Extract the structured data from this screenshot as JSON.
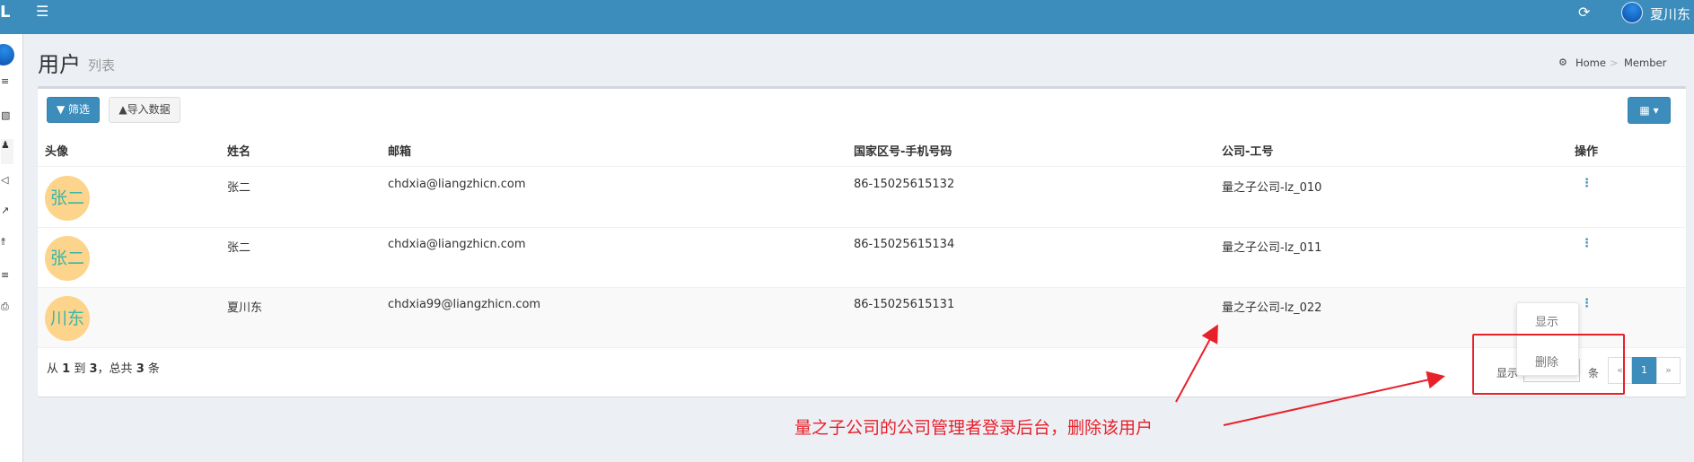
{
  "topbar": {
    "logo_letter": "L",
    "menu_icon": "hamburger-icon",
    "refresh_icon": "refresh-icon",
    "user_name": "夏川东"
  },
  "sidebar": {
    "icons": [
      "bars-icon",
      "book-icon",
      "user-icon",
      "megaphone-icon",
      "share-arrow-icon",
      "network-icon",
      "list-icon",
      "printer-icon"
    ]
  },
  "page": {
    "title": "用户",
    "subtitle": "列表"
  },
  "breadcrumb": {
    "home_icon": "dashboard-icon",
    "home": "Home",
    "separator": ">",
    "current": "Member"
  },
  "toolbar": {
    "filter_label": "筛选",
    "import_label": "导入数据",
    "columns_icon": "table-icon"
  },
  "table": {
    "headers": [
      "头像",
      "姓名",
      "邮箱",
      "国家区号-手机号码",
      "公司-工号",
      "操作"
    ],
    "rows": [
      {
        "avatar_text": "张二",
        "name": "张二",
        "email": "chdxia@liangzhicn.com",
        "phone": "86-15025615132",
        "company": "量之子公司-lz_010"
      },
      {
        "avatar_text": "张二",
        "name": "张二",
        "email": "chdxia@liangzhicn.com",
        "phone": "86-15025615134",
        "company": "量之子公司-lz_011"
      },
      {
        "avatar_text": "川东",
        "name": "夏川东",
        "email": "chdxia99@liangzhicn.com",
        "phone": "86-15025615131",
        "company": "量之子公司-lz_022"
      }
    ]
  },
  "summary": {
    "prefix": "从",
    "from": "1",
    "to_word": "到",
    "to": "3",
    "total_word": "，总共",
    "total": "3",
    "unit": "条"
  },
  "pagination": {
    "show_label": "显示",
    "unit_label": "条",
    "prev": "«",
    "current": "1",
    "next": "»"
  },
  "dropdown": {
    "items": [
      "显示",
      "删除"
    ]
  },
  "annotation": {
    "text": "量之子公司的公司管理者登录后台，删除该用户",
    "color": "#e8202a"
  },
  "colors": {
    "topbar": "#3c8dbc",
    "primary": "#3c8dbc",
    "avatar_bg": "#fcd48b",
    "avatar_text": "#3ab5a8"
  }
}
